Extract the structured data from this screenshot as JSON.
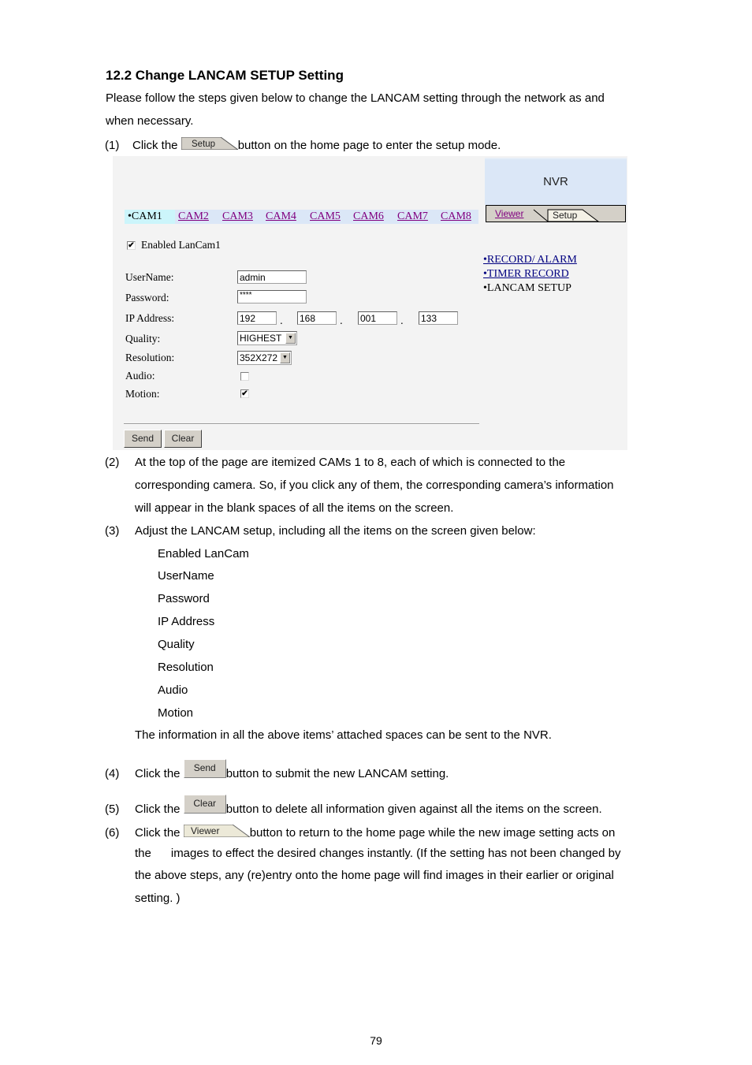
{
  "heading": "12.2 Change LANCAM SETUP Setting",
  "intro_line1": "Please follow the steps given below to change the LANCAM setting through the network as and",
  "intro_line2": "when necessary.",
  "step1": {
    "num": "(1)",
    "pre": "Click the",
    "button": "Setup",
    "post": "button on the home page to enter the setup mode."
  },
  "screenshot": {
    "brand": "NVR",
    "cams": [
      "•CAM1",
      "CAM2",
      "CAM3",
      "CAM4",
      "CAM5",
      "CAM6",
      "CAM7",
      "CAM8"
    ],
    "tabs": {
      "viewer": "Viewer",
      "setup": "Setup"
    },
    "side_menu": [
      "•RECORD/ ALARM",
      "•TIMER RECORD",
      "•LANCAM SETUP"
    ],
    "enabled_label": "Enabled LanCam1",
    "enabled_checked": true,
    "fields": {
      "username_label": "UserName:",
      "username_value": "admin",
      "password_label": "Password:",
      "password_value": "****",
      "ip_label": "IP Address:",
      "ip": [
        "192",
        "168",
        "001",
        "133"
      ],
      "ip_sep": ".",
      "quality_label": "Quality:",
      "quality_value": "HIGHEST",
      "resolution_label": "Resolution:",
      "resolution_value": "352X272",
      "audio_label": "Audio:",
      "audio_checked": false,
      "motion_label": "Motion:",
      "motion_checked": true
    },
    "buttons": {
      "send": "Send",
      "clear": "Clear"
    },
    "check_glyph": "✔"
  },
  "step2": {
    "num": "(2)",
    "lines": [
      "At the top of the page are itemized CAMs 1 to 8, each of which is connected to the",
      "corresponding camera. So, if you click any of them, the corresponding camera’s information",
      "will appear in the blank spaces of all the items on the screen."
    ]
  },
  "step3": {
    "num": "(3)",
    "text": "Adjust the LANCAM setup, including all the items on the screen given below:",
    "items": [
      "Enabled LanCam",
      "UserName",
      "Password",
      "IP Address",
      "Quality",
      "Resolution",
      "Audio",
      "Motion"
    ],
    "note": "The information in all the above items’ attached spaces can be sent to the NVR."
  },
  "step4": {
    "num": "(4)",
    "pre": "Click the",
    "button": "Send",
    "post": "button to submit the new LANCAM setting."
  },
  "step5": {
    "num": "(5)",
    "pre": "Click the",
    "button": "Clear",
    "post": "button to delete all information given against all the items on the screen."
  },
  "step6": {
    "num": "(6)",
    "pre": "Click the",
    "button": "Viewer",
    "post": "button to return to the home page while the new image setting acts on",
    "lines": [
      "the      images to effect the desired changes instantly. (If the setting has not been changed by",
      "the above steps, any (re)entry onto the home page will find images in their earlier or original",
      "setting. )"
    ]
  },
  "page_number": "79"
}
